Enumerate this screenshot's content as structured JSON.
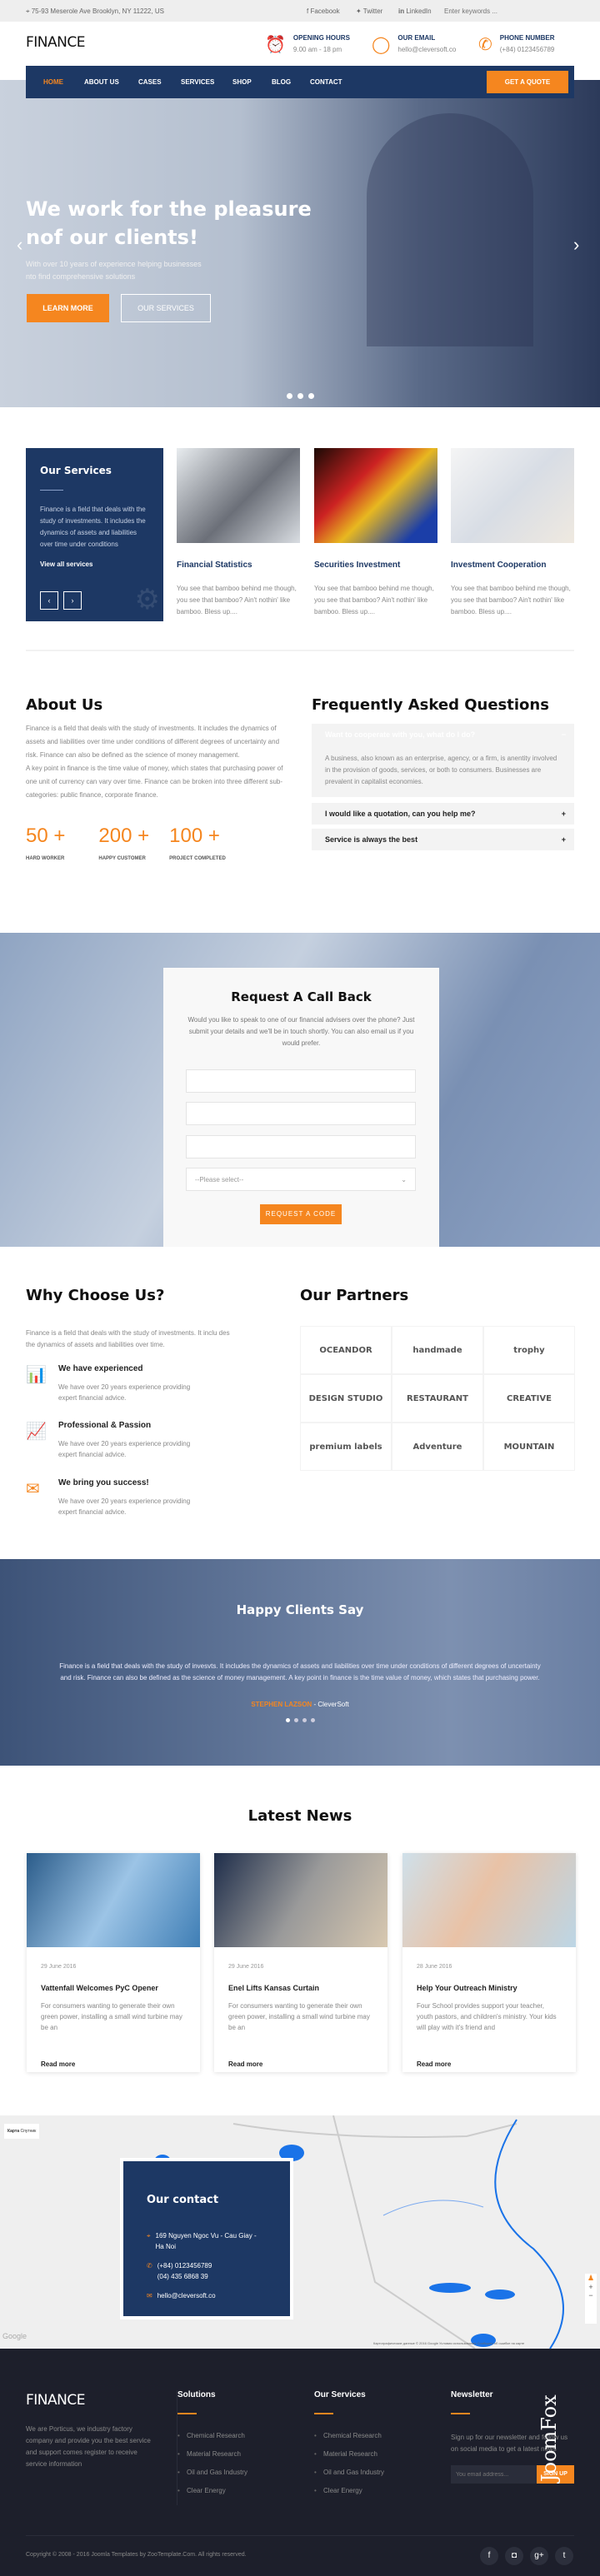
{
  "colors": {
    "navy": "#1d3864",
    "orange": "#f5861f",
    "footer": "#1d1f2b"
  },
  "topbar": {
    "address": "75-93 Meserole Ave Brooklyn, NY 11222, US",
    "facebook": "Facebook",
    "twitter": "Twitter",
    "linkedin": "LinkedIn",
    "search_placeholder": "Enter keywords ..."
  },
  "header": {
    "logo": "FINANCE",
    "hours_label": "OPENING HOURS",
    "hours": "9.00 am - 18 pm",
    "email_label": "OUR EMAIL",
    "email": "hello@cleversoft.co",
    "phone_label": "PHONE NUMBER",
    "phone": "(+84) 0123456789"
  },
  "nav": {
    "items": [
      "HOME",
      "ABOUT US",
      "CASES",
      "SERVICES",
      "SHOP",
      "BLOG",
      "CONTACT"
    ],
    "active": "HOME",
    "quote": "GET A QUOTE"
  },
  "hero": {
    "title1": "We work for the pleasure",
    "title2": "nof our clients!",
    "sub1": "With over 10 years of experience helping businesses",
    "sub2": "nto find comprehensive solutions",
    "learn": "LEARN MORE",
    "services": "OUR SERVICES",
    "slides": 3,
    "active_slide": 1
  },
  "services": {
    "title": "Our Services",
    "text": "Finance is a field that deals with the study of investments. It includes the dynamics of assets and liabilities over time under conditions",
    "link": "View all services",
    "cards": [
      {
        "title": "Financial Statistics",
        "text": "You see that bamboo behind me though, you see that bamboo? Ain't nothin' like bamboo. Bless up...."
      },
      {
        "title": "Securities Investment",
        "text": "You see that bamboo behind me though, you see that bamboo? Ain't nothin' like bamboo. Bless up...."
      },
      {
        "title": "Investment Cooperation",
        "text": "You see that bamboo behind me though, you see that bamboo? Ain't nothin' like bamboo. Bless up...."
      }
    ]
  },
  "about": {
    "title": "About Us",
    "p1": "Finance is a field that deals with the study of investments. It includes the dynamics of assets and liabilities over time under conditions of different degrees of uncertainty and risk. Finance can also be defined as the science of money management.",
    "p2": "A key point in finance is the time value of money, which states that purchasing power of one unit of currency can vary over time. Finance can be broken into three different sub-categories: public finance, corporate finance.",
    "stats": [
      {
        "num": "50 +",
        "label": "HARD WORKER"
      },
      {
        "num": "200 +",
        "label": "HAPPY CUSTOMER"
      },
      {
        "num": "100 +",
        "label": "PROJECT COMPLETED"
      }
    ]
  },
  "faq": {
    "title": "Frequently Asked Questions",
    "items": [
      {
        "q": "Want to cooperate with you, what do I do?",
        "a": "A business, also known as an enterprise, agency, or a firm, is anentity involved in the provision of goods, services, or both to consumers. Businesses are prevalent in capitalist economies.",
        "open": true
      },
      {
        "q": "I would like a quotation, can you help me?"
      },
      {
        "q": "Service is always the best"
      }
    ]
  },
  "callback": {
    "title": "Request A Call Back",
    "text": "Would you like to speak to one of our financial advisers over the phone? Just submit your details and we'll be in touch shortly. You can also email us if you would prefer.",
    "select": "--Please select--",
    "button": "REQUEST A CODE"
  },
  "why": {
    "title": "Why Choose Us?",
    "text": "Finance is a field that deals with the study of investments. It inclu des the dynamics of assets and liabilities over time.",
    "items": [
      {
        "title": "We have experienced",
        "text": "We have over 20 years experience providing expert financial advice."
      },
      {
        "title": "Professional & Passion",
        "text": "We have over 20 years experience providing expert financial advice."
      },
      {
        "title": "We bring you success!",
        "text": "We have over 20 years experience providing expert financial advice."
      }
    ]
  },
  "partners": {
    "title": "Our Partners",
    "logos": [
      "OCEANDOR",
      "handmade",
      "trophy",
      "DESIGN STUDIO",
      "RESTAURANT",
      "CREATIVE",
      "premium labels",
      "Adventure",
      "MOUNTAIN"
    ]
  },
  "testimonial": {
    "title": "Happy Clients Say",
    "text": "Finance is a field that deals with the study of invesvts. It includes the dynamics of assets and liabilities over time under conditions of different degrees of uncertainty and risk. Finance can also be defined as the science of money management. A key point in finance is the time value of money, which states that purchasing power.",
    "name": "STEPHEN LAZSON",
    "company": " - CleverSoft",
    "slides": 4,
    "active_slide": 1
  },
  "news": {
    "title": "Latest News",
    "items": [
      {
        "date": "29 June 2016",
        "title": "Vattenfall Welcomes PyC Opener",
        "text": "For consumers wanting to generate their own green power, installing a small wind turbine may be an",
        "more": "Read more"
      },
      {
        "date": "29 June 2016",
        "title": "Enel Lifts Kansas Curtain",
        "text": "For consumers wanting to generate their own green power, installing a small wind turbine may be an",
        "more": "Read more"
      },
      {
        "date": "28 June 2016",
        "title": "Help Your Outreach Ministry",
        "text": "Four School provides support your teacher, youth pastors, and children's ministry. Your kids will play with it's friend and",
        "more": "Read more"
      }
    ]
  },
  "map": {
    "tab_map": "Карта",
    "tab_sat": "Спутник",
    "attribution": "Картографические данные © 2016 Google",
    "terms": "Условия использования",
    "report": "Сообщить об ошибке на карте",
    "google": "Google"
  },
  "contact": {
    "title": "Our contact",
    "address": "169 Nguyen Ngoc Vu - Cau Giay - Ha Noi",
    "phone1": "(+84) 0123456789",
    "phone2": "(04) 435 6868 39",
    "email": "hello@cleversoft.co"
  },
  "footer": {
    "logo": "FINANCE",
    "about": "We are Porticus, we industry factory company and provide you the best service and support comes register to receive service information",
    "solutions_title": "Solutions",
    "solutions": [
      "Chemical Research",
      "Material Research",
      "Oil and Gas Industry",
      "Clear Energy"
    ],
    "services_title": "Our Services",
    "services": [
      "Chemical Research",
      "Material Research",
      "Oil and Gas Industry",
      "Clear Energy"
    ],
    "newsletter_title": "Newsletter",
    "newsletter_text": "Sign up for our newsletter and follow us on social media to get a latest news",
    "email_placeholder": "You email address...",
    "signup": "SIGN UP",
    "copyright": "Copyright © 2008 - 2016 Joomla Templates by ZooTemplate.Com. All rights reserved.",
    "watermark": "JoomFox CREATIVE WEB STUDIO"
  }
}
